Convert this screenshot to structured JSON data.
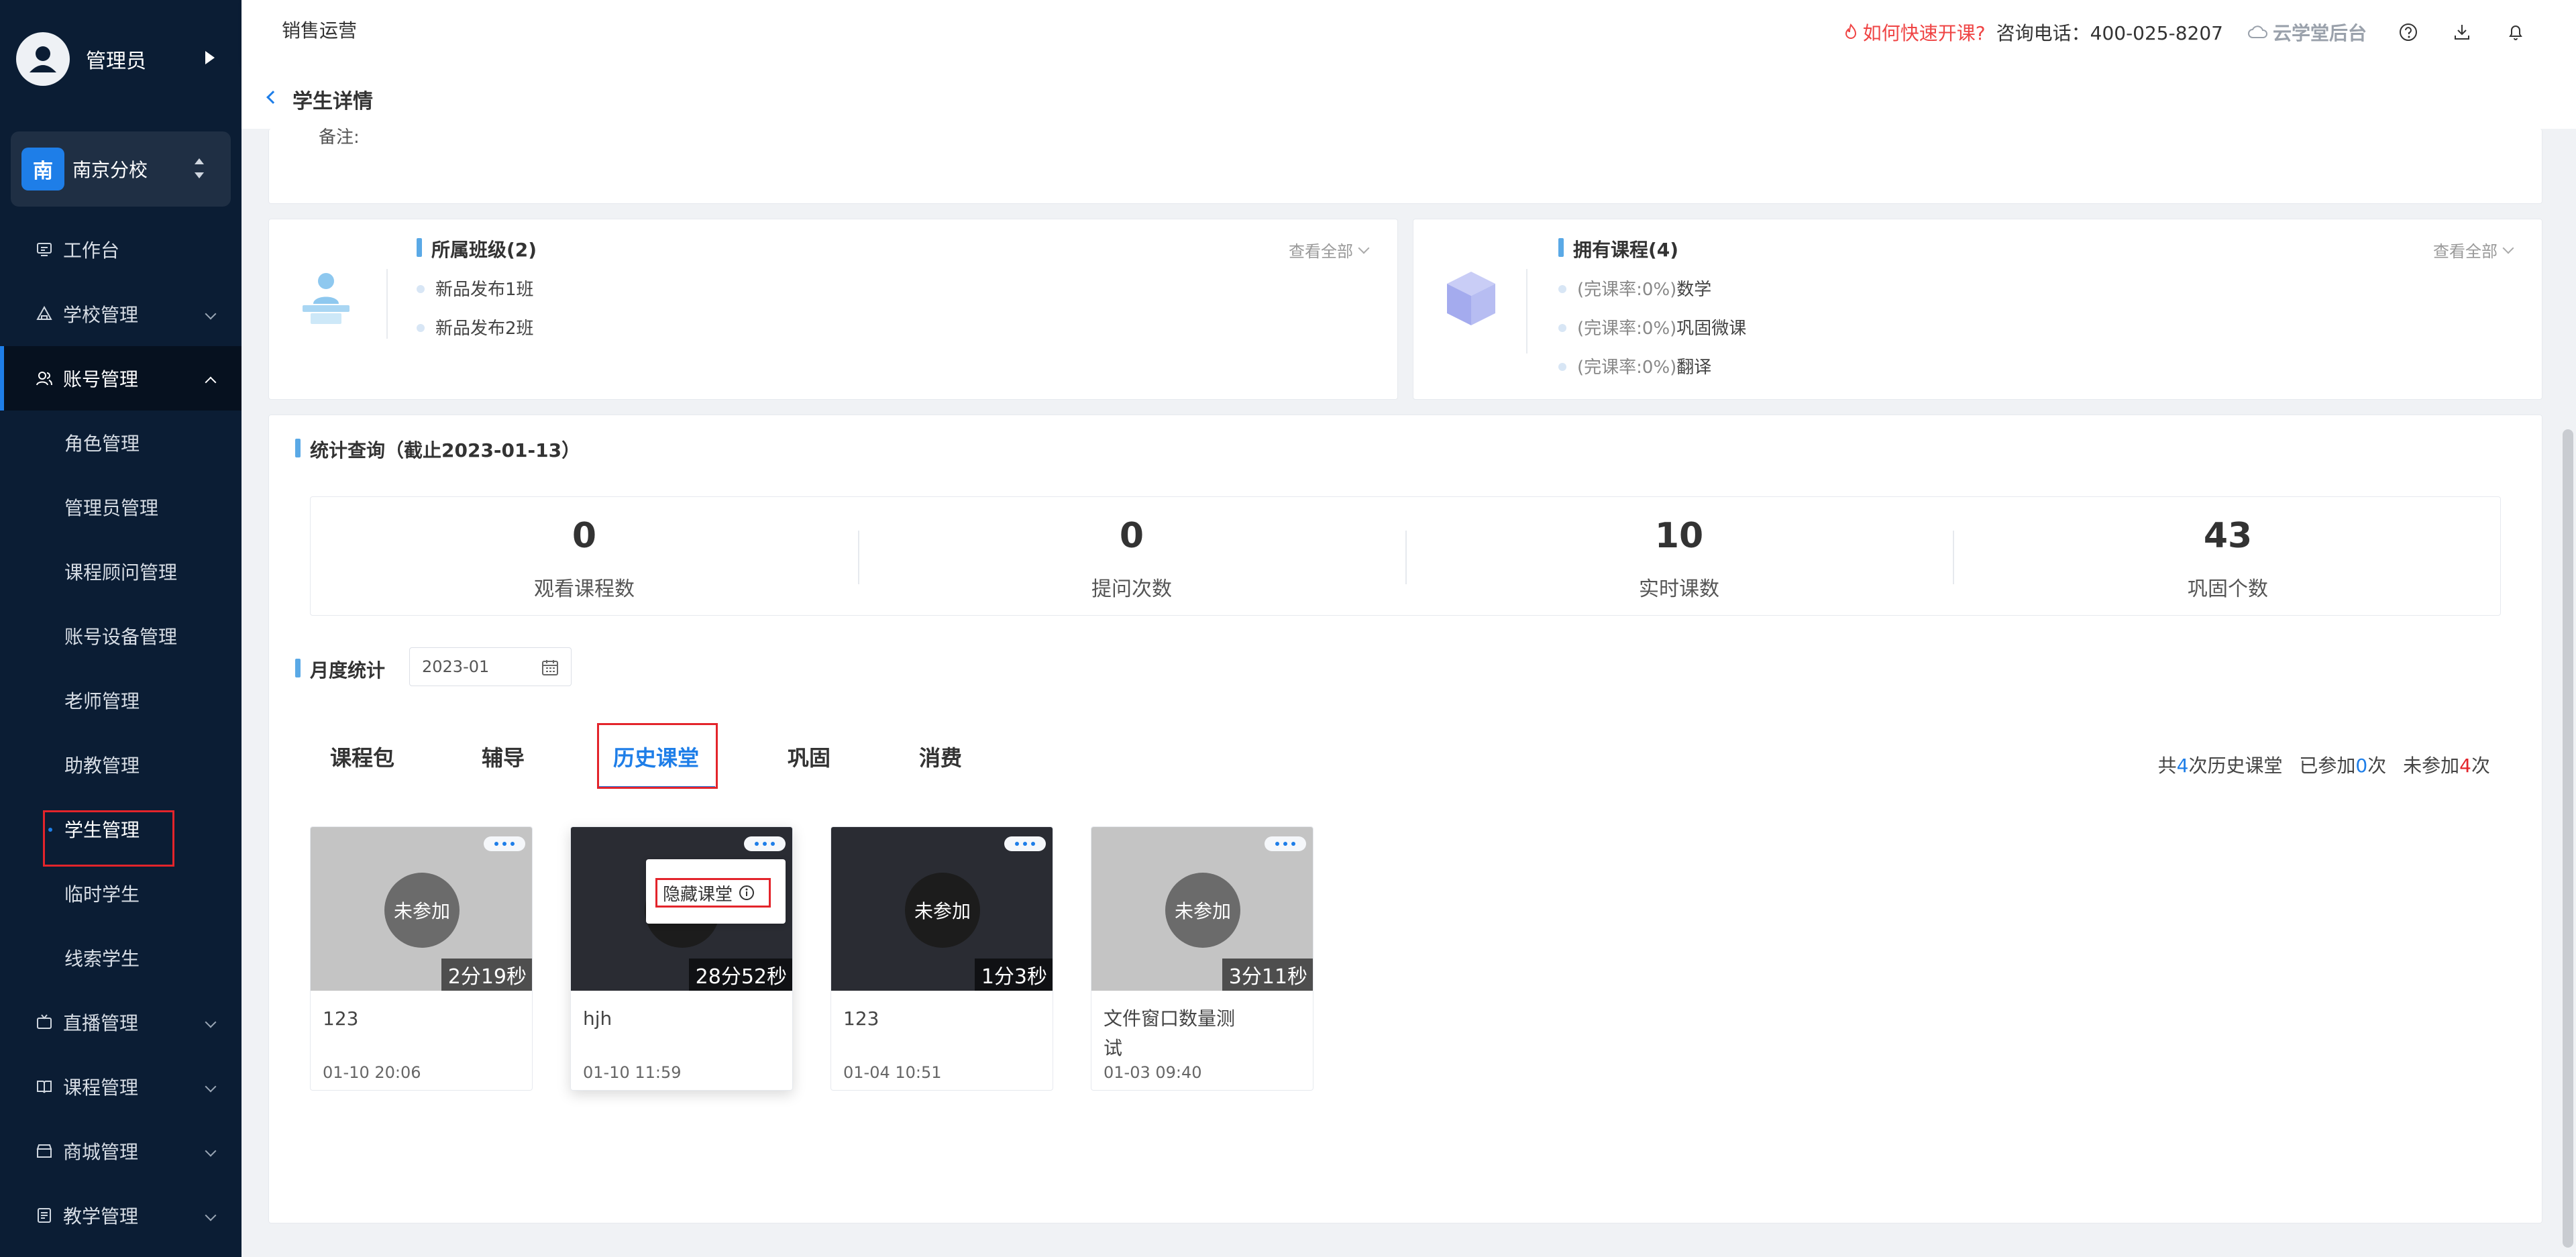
{
  "sidebar": {
    "user_name": "管理员",
    "school_badge": "南",
    "school_name": "南京分校",
    "menu": {
      "workbench": "工作台",
      "school": "学校管理",
      "account": "账号管理",
      "live": "直播管理",
      "course": "课程管理",
      "mall": "商城管理",
      "teaching": "教学管理"
    },
    "submenu": {
      "role": "角色管理",
      "admin": "管理员管理",
      "advisor": "课程顾问管理",
      "device": "账号设备管理",
      "teacher": "老师管理",
      "assistant": "助教管理",
      "student": "学生管理",
      "temp": "临时学生",
      "lead": "线索学生"
    }
  },
  "topbar": {
    "title": "销售运营",
    "quick_link": "如何快速开课?",
    "phone": "咨询电话：400-025-8207",
    "backend": "云学堂后台"
  },
  "subheader": {
    "title": "学生详情"
  },
  "remark_label": "备注:",
  "classes": {
    "title": "所属班级(2)",
    "view_all": "查看全部",
    "items": [
      "新品发布1班",
      "新品发布2班"
    ]
  },
  "courses": {
    "title": "拥有课程(4)",
    "view_all": "查看全部",
    "items": [
      {
        "rate": "(完课率:0%)",
        "name": "数学"
      },
      {
        "rate": "(完课率:0%)",
        "name": "巩固微课"
      },
      {
        "rate": "(完课率:0%)",
        "name": "翻译"
      }
    ]
  },
  "stats": {
    "title": "统计查询（截止2023-01-13）",
    "items": [
      {
        "value": "0",
        "label": "观看课程数"
      },
      {
        "value": "0",
        "label": "提问次数"
      },
      {
        "value": "10",
        "label": "实时课数"
      },
      {
        "value": "43",
        "label": "巩固个数"
      }
    ]
  },
  "monthly": {
    "title": "月度统计",
    "month": "2023-01"
  },
  "tabs": [
    "课程包",
    "辅导",
    "历史课堂",
    "巩固",
    "消费"
  ],
  "summary": {
    "prefix": "共",
    "total": "4",
    "total_suffix": "次历史课堂",
    "joined_prefix": "已参加",
    "joined": "0",
    "joined_suffix": "次",
    "missed_prefix": "未参加",
    "missed": "4",
    "missed_suffix": "次"
  },
  "cards": [
    {
      "status": "未参加",
      "duration": "2分19秒",
      "title": "123",
      "date": "01-10 20:06"
    },
    {
      "status": "",
      "duration": "28分52秒",
      "title": "hjh",
      "date": "01-10 11:59",
      "popup": "隐藏课堂"
    },
    {
      "status": "未参加",
      "duration": "1分3秒",
      "title": "123",
      "date": "01-04 10:51"
    },
    {
      "status": "未参加",
      "duration": "3分11秒",
      "title": "文件窗口数量测试",
      "date": "01-03 09:40"
    }
  ]
}
